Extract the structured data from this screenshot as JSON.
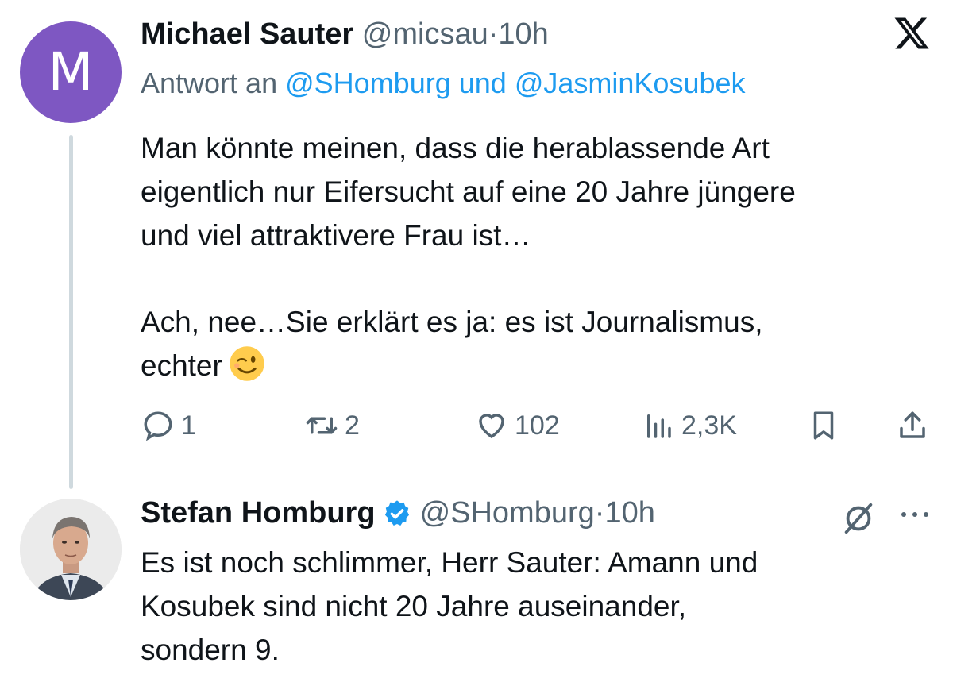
{
  "tweet1": {
    "avatar_letter": "M",
    "name": "Michael Sauter",
    "handle": "@micsau",
    "separator": "·",
    "time": "10h",
    "reply_prefix": "Antwort an",
    "reply_mention1": "@SHomburg",
    "reply_and": "und",
    "reply_mention2": "@JasminKosubek",
    "text_line1": "Man könnte meinen, dass die herablassende Art",
    "text_line2": "eigentlich nur Eifersucht auf eine 20 Jahre jüngere",
    "text_line3": "und viel attraktivere Frau ist…",
    "text_line4": "Ach, nee…Sie erklärt es ja: es ist Journalismus,",
    "text_line5": "echter",
    "emoji": "winking-face",
    "actions": {
      "replies": "1",
      "reposts": "2",
      "likes": "102",
      "views": "2,3K"
    }
  },
  "tweet2": {
    "name": "Stefan Homburg",
    "handle": "@SHomburg",
    "separator": "·",
    "time": "10h",
    "text_line1": "Es ist noch schlimmer, Herr Sauter: Amann und",
    "text_line2": "Kosubek sind nicht 20 Jahre auseinander,",
    "text_line3": "sondern 9."
  },
  "colors": {
    "accent": "#1d9bf0",
    "secondary_text": "#536471",
    "primary_text": "#0f1419",
    "avatar_m": "#7e57c2",
    "thread_line": "#cfd9de"
  }
}
